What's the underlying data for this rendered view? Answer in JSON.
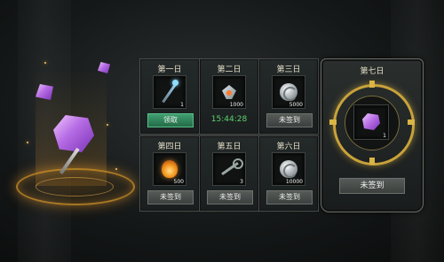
{
  "days": [
    {
      "title": "第一日",
      "item": "staff-icon",
      "qty": "1",
      "action": "领取",
      "state": "claimable"
    },
    {
      "title": "第二日",
      "item": "claw-icon",
      "qty": "1000",
      "action": "15:44:28",
      "state": "timer"
    },
    {
      "title": "第三日",
      "item": "silver-orb-icon",
      "qty": "5000",
      "action": "未签到",
      "state": "unsigned"
    },
    {
      "title": "第四日",
      "item": "fire-crystal-icon",
      "qty": "500",
      "action": "未签到",
      "state": "unsigned"
    },
    {
      "title": "第五日",
      "item": "key-icon",
      "qty": "3",
      "action": "未签到",
      "state": "unsigned"
    },
    {
      "title": "第六日",
      "item": "silver-orb-icon",
      "qty": "10000",
      "action": "未签到",
      "state": "unsigned"
    }
  ],
  "day7": {
    "title": "第七日",
    "item": "purple-gem-icon",
    "qty": "1",
    "action": "未签到"
  },
  "colors": {
    "claim_button": "#2f855a",
    "timer_text": "#5fd36f",
    "ring_gold": "#c8a23a"
  }
}
